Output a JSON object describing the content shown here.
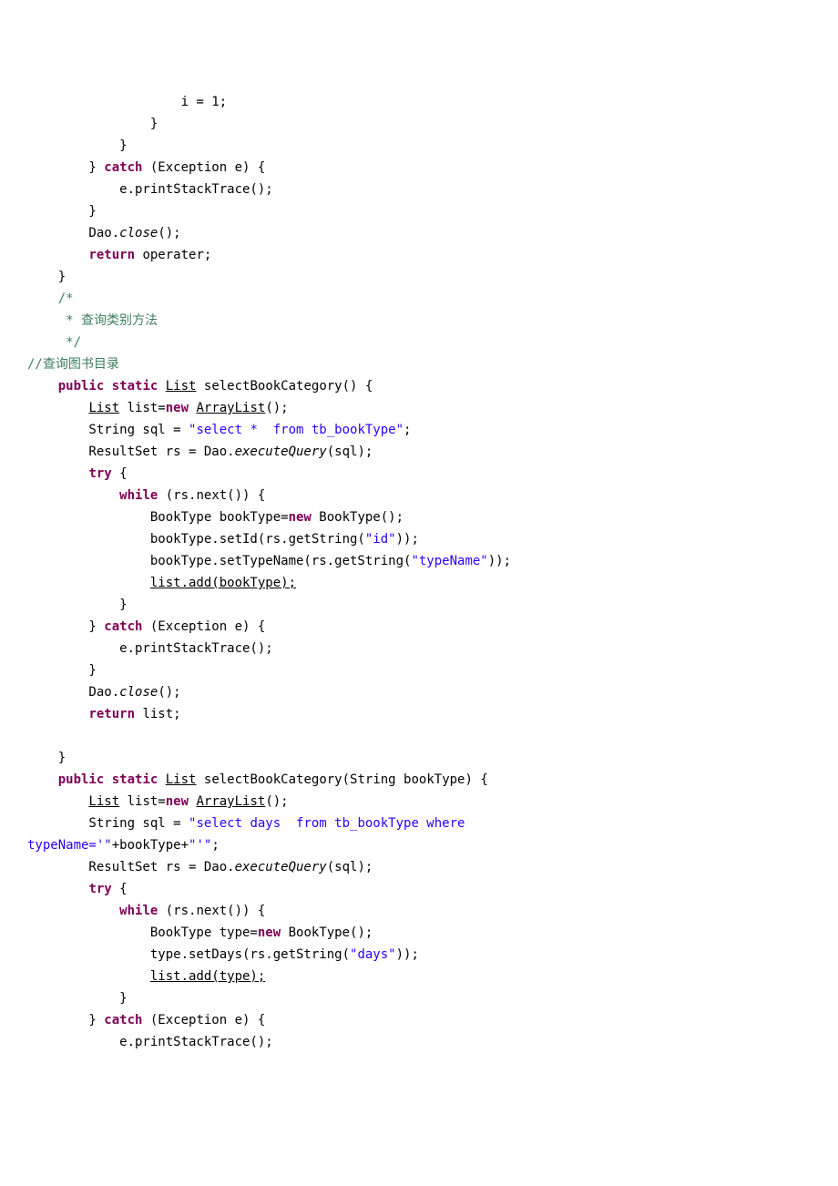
{
  "code": {
    "l01": "                    i = 1;",
    "l02": "                }",
    "l03": "            }",
    "l04a": "        } ",
    "l04_catch": "catch",
    "l04b": " (Exception e) {",
    "l05": "            e.printStackTrace();",
    "l06": "        }",
    "l07a": "        Dao.",
    "l07_close": "close",
    "l07b": "();",
    "l08a": "        ",
    "l08_return": "return",
    "l08b": " operater;",
    "l09": "    }",
    "l10": "    /*",
    "l11": "     * 查询类别方法",
    "l12": "     */",
    "l13": "//查询图书目录",
    "l14a": "    ",
    "l14_public": "public",
    "l14_sp": " ",
    "l14_static": "static",
    "l14_sp2": " ",
    "l14_List": "List",
    "l14b": " selectBookCategory() {",
    "l15a": "        ",
    "l15_List": "List",
    "l15b": " list=",
    "l15_new": "new",
    "l15_sp": " ",
    "l15_ArrayList": "ArrayList",
    "l15c": "();",
    "l16a": "        String sql = ",
    "l16_str": "\"select *  from tb_bookType\"",
    "l16b": ";",
    "l17a": "        ResultSet rs = Dao.",
    "l17_exec": "executeQuery",
    "l17b": "(sql);",
    "l18a": "        ",
    "l18_try": "try",
    "l18b": " {",
    "l19a": "            ",
    "l19_while": "while",
    "l19b": " (rs.next()) {",
    "l20a": "                BookType bookType=",
    "l20_new": "new",
    "l20b": " BookType();",
    "l21a": "                bookType.setId(rs.getString(",
    "l21_str": "\"id\"",
    "l21b": "));",
    "l22a": "                bookType.setTypeName(rs.getString(",
    "l22_str": "\"typeName\"",
    "l22b": "));",
    "l23a": "                ",
    "l23_add": "list.add(bookType);",
    "l24": "            }",
    "l25a": "        } ",
    "l25_catch": "catch",
    "l25b": " (Exception e) {",
    "l26": "            e.printStackTrace();",
    "l27": "        }",
    "l28a": "        Dao.",
    "l28_close": "close",
    "l28b": "();",
    "l29a": "        ",
    "l29_return": "return",
    "l29b": " list;",
    "blank": "",
    "l31": "    }",
    "l32a": "    ",
    "l32_public": "public",
    "l32_sp": " ",
    "l32_static": "static",
    "l32_sp2": " ",
    "l32_List": "List",
    "l32b": " selectBookCategory(String bookType) {",
    "l33a": "        ",
    "l33_List": "List",
    "l33b": " list=",
    "l33_new": "new",
    "l33_sp": " ",
    "l33_ArrayList": "ArrayList",
    "l33c": "();",
    "l34a": "        String sql = ",
    "l34_str1": "\"select days  from tb_bookType where ",
    "l34_str2": "typeName='\"",
    "l34_mid": "+bookType+",
    "l34_str3": "\"'\"",
    "l34b": ";",
    "l35a": "        ResultSet rs = Dao.",
    "l35_exec": "executeQuery",
    "l35b": "(sql);",
    "l36a": "        ",
    "l36_try": "try",
    "l36b": " {",
    "l37a": "            ",
    "l37_while": "while",
    "l37b": " (rs.next()) {",
    "l38a": "                BookType type=",
    "l38_new": "new",
    "l38b": " BookType();",
    "l39a": "                type.setDays(rs.getString(",
    "l39_str": "\"days\"",
    "l39b": "));",
    "l40a": "                ",
    "l40_add": "list.add(type);",
    "l41": "            }",
    "l42a": "        } ",
    "l42_catch": "catch",
    "l42b": " (Exception e) {",
    "l43": "            e.printStackTrace();"
  }
}
